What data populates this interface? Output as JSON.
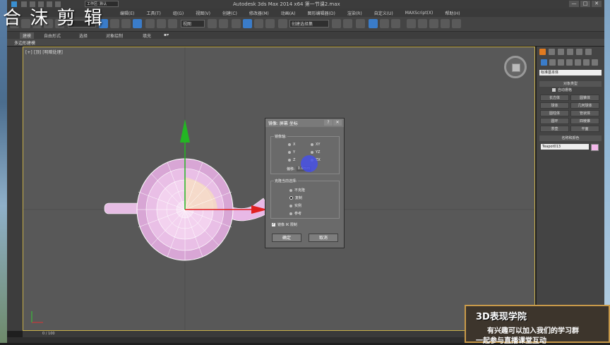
{
  "window": {
    "title": "Autodesk 3ds Max  2014 x64     第一节课2.max",
    "workspace": "工作区: 默认",
    "controls": [
      "—",
      "□",
      "✕"
    ]
  },
  "menu": [
    "编辑(E)",
    "工具(T)",
    "组(G)",
    "视图(V)",
    "创建(C)",
    "修改器(M)",
    "动画(A)",
    "图形编辑器(D)",
    "渲染(R)",
    "自定义(U)",
    "MAXScript(X)",
    "帮助(H)"
  ],
  "toolbar": {
    "view_select": "视图",
    "selection_set": "创建选择集"
  },
  "ribbon": {
    "tabs": [
      "建模",
      "自由形式",
      "选择",
      "对象绘制",
      "填充"
    ],
    "sub_label": "多边形建模"
  },
  "viewport": {
    "label": "[+] [顶] [明暗处理]"
  },
  "command_panel": {
    "category_dropdown": "标准基本体",
    "object_type_header": "对象类型",
    "autogrid_label": "自动栅格",
    "buttons": [
      "长方体",
      "圆锥体",
      "球体",
      "几何球体",
      "圆柱体",
      "管状体",
      "圆环",
      "四棱锥",
      "茶壶",
      "平面"
    ],
    "name_color_header": "名称和颜色",
    "object_name": "Teapot013",
    "object_color": "#f3b7ea"
  },
  "mirror_dialog": {
    "title": "镜像: 屏幕 坐标",
    "title_controls": [
      "?",
      "✕"
    ],
    "axis_group_label": "镜像轴:",
    "axes": [
      {
        "label": "X",
        "selected": false
      },
      {
        "label": "XY",
        "selected": false
      },
      {
        "label": "Y",
        "selected": false
      },
      {
        "label": "YZ",
        "selected": false
      },
      {
        "label": "Z",
        "selected": false
      },
      {
        "label": "ZX",
        "selected": false
      }
    ],
    "offset_label": "偏移:",
    "offset_value": "0.0mm",
    "clone_group_label": "克隆当前选择:",
    "clone_options": [
      {
        "label": "不克隆",
        "selected": false
      },
      {
        "label": "复制",
        "selected": true
      },
      {
        "label": "实例",
        "selected": false
      },
      {
        "label": "参考",
        "selected": false
      }
    ],
    "ik_label": "镜像 IK 限制",
    "ik_checked": true,
    "ok_label": "确定",
    "cancel_label": "取消"
  },
  "timeline": {
    "frame_counter": "0 / 100"
  },
  "overlay": {
    "watermark": "合 沫 剪 辑",
    "banner_title": "3D表现学院",
    "banner_line1": "有兴趣可以加入我们的学习群",
    "banner_line2": "一起参与直播课堂互动"
  },
  "colors": {
    "viewport_bg": "#585858",
    "teapot": "#f1c6ef",
    "gizmo_y": "#23b623",
    "gizmo_x": "#e02020",
    "cursor_highlight": "#4650e6"
  }
}
